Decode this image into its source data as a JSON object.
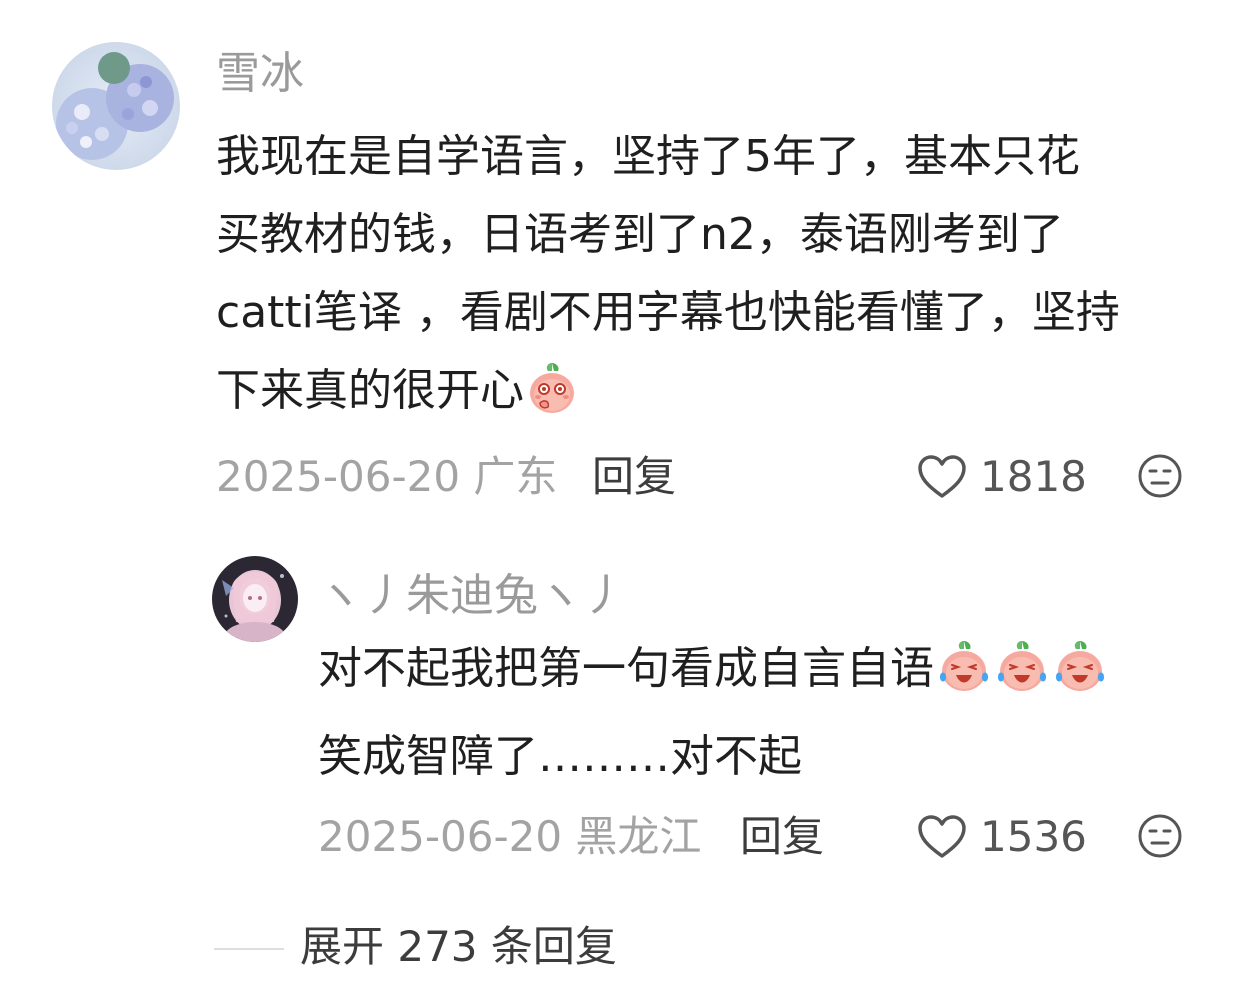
{
  "comment": {
    "username": "雪冰",
    "text_lines": [
      "我现在是自学语言，坚持了5年了，基本只花",
      "买教材的钱，日语考到了n2，泰语刚考到了",
      "catti笔译 ，看剧不用字幕也快能看懂了，坚持",
      "下来真的很开心"
    ],
    "emoji": "shy-peach-emoji",
    "date_location": "2025-06-20 广东",
    "reply_label": "回复",
    "like_count": "1818",
    "avatar_icon": "hydrangea-flower-avatar"
  },
  "reply": {
    "username": "ヽ丿朱迪兔ヽ丿",
    "text_lines": [
      "对不起我把第一句看成自言自语",
      "笑成智障了………对不起"
    ],
    "emojis": [
      "crying-laughing-peach-emoji",
      "crying-laughing-peach-emoji",
      "crying-laughing-peach-emoji"
    ],
    "date_location": "2025-06-20 黑龙江",
    "reply_label": "回复",
    "like_count": "1536",
    "avatar_icon": "anime-girl-avatar"
  },
  "expand_replies": "展开 273 条回复",
  "colors": {
    "text": "#1f1f1f",
    "muted": "#9a9a9a",
    "action": "#3c3c3c",
    "peach": "#f6a99e"
  }
}
